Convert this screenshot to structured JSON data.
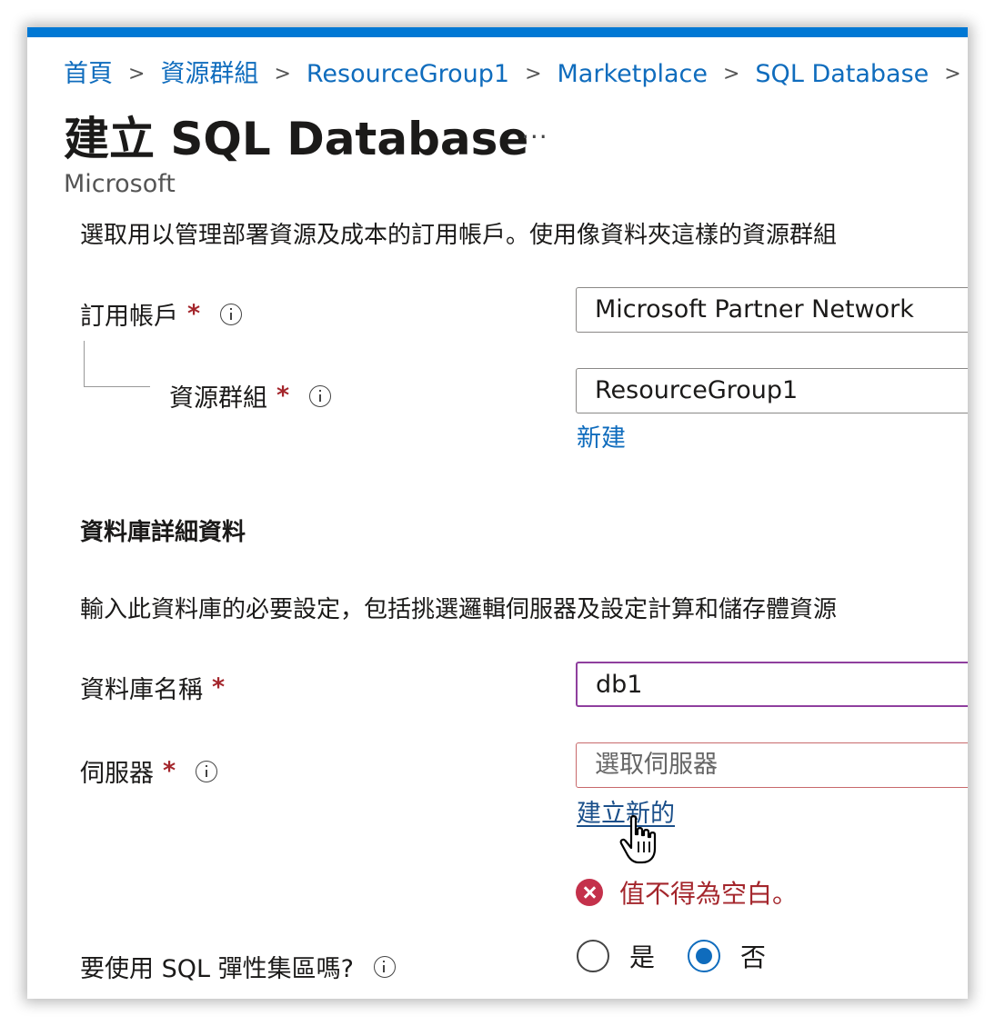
{
  "colors": {
    "accent": "#0078d4",
    "link": "#0f6cbd",
    "error": "#a4262c",
    "focus": "#8f3f9e"
  },
  "breadcrumb": [
    "首頁",
    "資源群組",
    "ResourceGroup1",
    "Marketplace",
    "SQL Database"
  ],
  "breadcrumb_separator": ">",
  "page": {
    "title": "建立 SQL Database",
    "more": "···",
    "publisher": "Microsoft"
  },
  "subscription_desc": "選取用以管理部署資源及成本的訂用帳戶。使用像資料夾這樣的資源群組",
  "subscription": {
    "label": "訂用帳戶",
    "value": "Microsoft Partner Network"
  },
  "resource_group": {
    "label": "資源群組",
    "value": "ResourceGroup1",
    "create_new": "新建"
  },
  "db_details": {
    "heading": "資料庫詳細資料",
    "desc": "輸入此資料庫的必要設定，包括挑選邏輯伺服器及設定計算和儲存體資源"
  },
  "db_name": {
    "label": "資料庫名稱",
    "value": "db1"
  },
  "server": {
    "label": "伺服器",
    "placeholder": "選取伺服器",
    "create_new": "建立新的",
    "error": "值不得為空白。"
  },
  "elastic_pool": {
    "label": "要使用 SQL 彈性集區嗎?",
    "option_yes": "是",
    "option_no": "否",
    "selected": "否"
  },
  "required_mark": "*",
  "icons": [
    "info-icon",
    "error-icon",
    "hand-pointer-cursor",
    "chevron-right-icon"
  ]
}
